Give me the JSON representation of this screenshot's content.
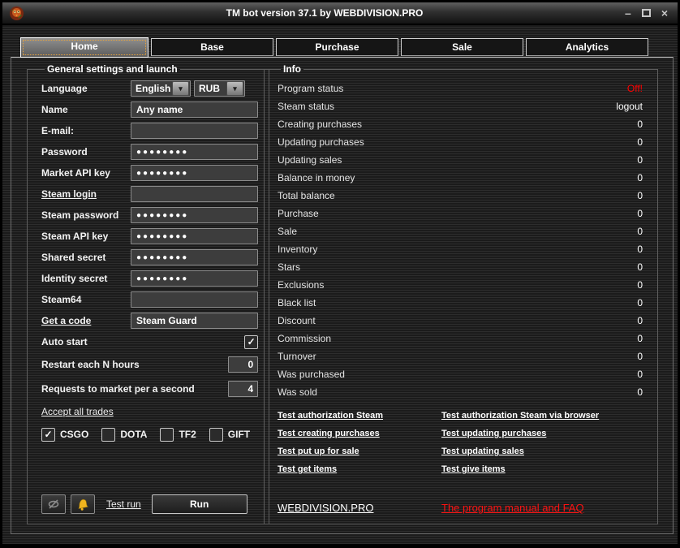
{
  "window": {
    "title": "TM bot version 37.1 by WEBDIVISION.PRO"
  },
  "icons": {
    "dropdown": "▾",
    "check": "✓",
    "minimize": "–",
    "close": "×"
  },
  "tabs": {
    "home": "Home",
    "base": "Base",
    "purchase": "Purchase",
    "sale": "Sale",
    "analytics": "Analytics"
  },
  "general": {
    "title": "General settings and launch",
    "language": {
      "label": "Language",
      "value": "English"
    },
    "currency": {
      "value": "RUB"
    },
    "name": {
      "label": "Name",
      "value": "Any name"
    },
    "email": {
      "label": "E-mail:",
      "value": ""
    },
    "password": {
      "label": "Password",
      "value": "●●●●●●●●"
    },
    "market_api_key": {
      "label": "Market API key",
      "value": "●●●●●●●●"
    },
    "steam_login": {
      "label": "Steam login",
      "value": ""
    },
    "steam_password": {
      "label": "Steam password",
      "value": "●●●●●●●●"
    },
    "steam_api_key": {
      "label": "Steam API key",
      "value": "●●●●●●●●"
    },
    "shared_secret": {
      "label": "Shared secret",
      "value": "●●●●●●●●"
    },
    "identity_secret": {
      "label": "Identity secret",
      "value": "●●●●●●●●"
    },
    "steam64": {
      "label": "Steam64",
      "value": ""
    },
    "get_a_code": {
      "label": "Get a code",
      "value": "Steam Guard"
    },
    "auto_start": {
      "label": "Auto start",
      "checked": true
    },
    "restart_hours": {
      "label": "Restart each N hours",
      "value": "0"
    },
    "requests_per_second": {
      "label": "Requests to market per a second",
      "value": "4"
    },
    "accept_all_trades": "Accept all trades",
    "games": [
      {
        "label": "CSGO",
        "checked": true
      },
      {
        "label": "DOTA",
        "checked": false
      },
      {
        "label": "TF2",
        "checked": false
      },
      {
        "label": "GIFT",
        "checked": false
      }
    ],
    "test_run": "Test run",
    "run": "Run"
  },
  "info": {
    "title": "Info",
    "status_off_color": "#ff0000",
    "rows": [
      {
        "label": "Program status",
        "value": "Off!"
      },
      {
        "label": "Steam status",
        "value": "logout"
      },
      {
        "label": "Creating purchases",
        "value": "0"
      },
      {
        "label": "Updating purchases",
        "value": "0"
      },
      {
        "label": "Updating sales",
        "value": "0"
      },
      {
        "label": "Balance in money",
        "value": "0"
      },
      {
        "label": "Total balance",
        "value": "0"
      },
      {
        "label": "Purchase",
        "value": "0"
      },
      {
        "label": "Sale",
        "value": "0"
      },
      {
        "label": "Inventory",
        "value": "0"
      },
      {
        "label": "Stars",
        "value": "0"
      },
      {
        "label": "Exclusions",
        "value": "0"
      },
      {
        "label": "Black list",
        "value": "0"
      },
      {
        "label": "Discount",
        "value": "0"
      },
      {
        "label": "Commission",
        "value": "0"
      },
      {
        "label": "Turnover",
        "value": "0"
      },
      {
        "label": "Was purchased",
        "value": "0"
      },
      {
        "label": "Was sold",
        "value": "0"
      }
    ],
    "links_left": [
      "Test authorization Steam",
      "Test creating purchases",
      "Test put up for sale",
      "Test get items"
    ],
    "links_right": [
      "Test authorization Steam via browser",
      "Test updating purchases",
      "Test updating sales",
      "Test give items"
    ],
    "site_link": "WEBDIVISION.PRO",
    "manual_link": "The program manual and FAQ"
  }
}
